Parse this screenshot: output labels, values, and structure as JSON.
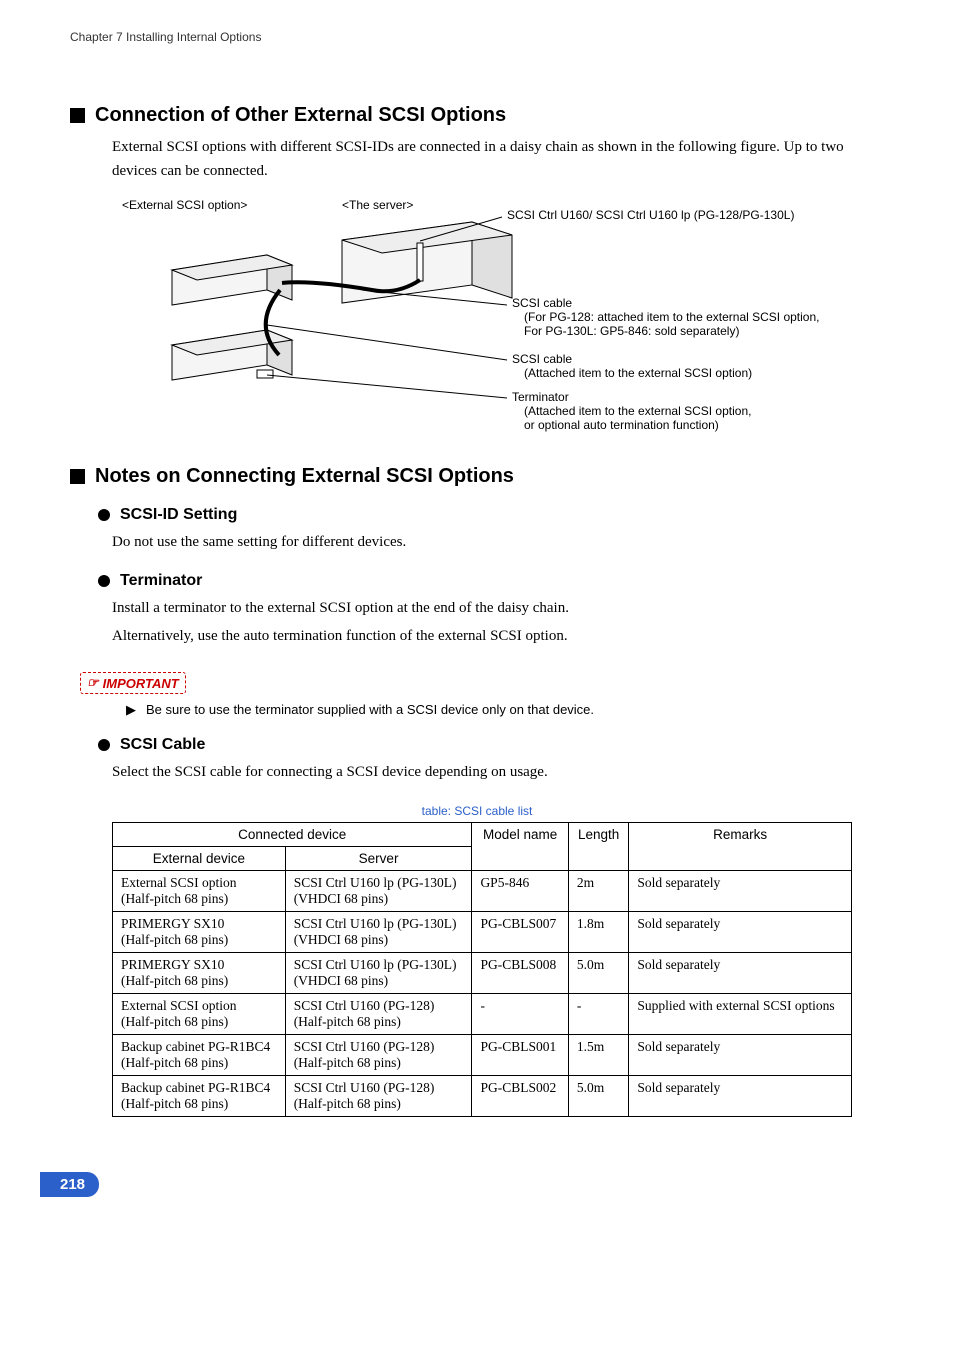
{
  "chapter_header": "Chapter 7  Installing Internal Options",
  "section1": {
    "title": "Connection of Other External SCSI Options",
    "para": "External SCSI options with different SCSI-IDs are connected in a daisy chain as shown in the following figure. Up to two devices can be connected."
  },
  "figure": {
    "labels": {
      "ext_option": "<External SCSI option>",
      "server": "<The server>",
      "ctrl": "SCSI Ctrl U160/ SCSI Ctrl U160 lp (PG-128/PG-130L)",
      "cable1_title": "SCSI cable",
      "cable1_l1": "(For PG-128: attached item to the external SCSI option,",
      "cable1_l2": " For PG-130L: GP5-846: sold separately)",
      "cable2_title": "SCSI cable",
      "cable2_l1": "(Attached item to the external SCSI option)",
      "term_title": "Terminator",
      "term_l1": "(Attached item to the external SCSI option,",
      "term_l2": " or optional auto termination function)"
    }
  },
  "section2": {
    "title": "Notes on Connecting External SCSI Options",
    "sub_scsi_id": {
      "title": "SCSI-ID Setting",
      "text": "Do not use the same setting for different devices."
    },
    "sub_term": {
      "title": "Terminator",
      "text1": "Install a terminator to the external SCSI option at the end of the daisy chain.",
      "text2": "Alternatively, use the auto termination function of the external SCSI option."
    },
    "important_label": "IMPORTANT",
    "important_note": "Be sure to use the terminator supplied with a SCSI device only on that device.",
    "sub_cable": {
      "title": "SCSI Cable",
      "text": "Select the SCSI cable for connecting a SCSI device depending on usage."
    }
  },
  "table": {
    "caption": "table: SCSI cable list",
    "headers": {
      "connected": "Connected device",
      "external": "External device",
      "server": "Server",
      "model": "Model name",
      "length": "Length",
      "remarks": "Remarks"
    },
    "rows": [
      {
        "ext_l1": "External SCSI option",
        "ext_l2": "(Half-pitch 68 pins)",
        "srv_l1": "SCSI Ctrl U160 lp (PG-130L)",
        "srv_l2": "(VHDCI 68 pins)",
        "model": "GP5-846",
        "length": "2m",
        "remarks": "Sold separately"
      },
      {
        "ext_l1": "PRIMERGY SX10",
        "ext_l2": "(Half-pitch 68 pins)",
        "srv_l1": "SCSI Ctrl U160 lp (PG-130L)",
        "srv_l2": "(VHDCI 68 pins)",
        "model": "PG-CBLS007",
        "length": "1.8m",
        "remarks": "Sold separately"
      },
      {
        "ext_l1": "PRIMERGY SX10",
        "ext_l2": "(Half-pitch 68 pins)",
        "srv_l1": "SCSI Ctrl U160 lp (PG-130L)",
        "srv_l2": "(VHDCI 68 pins)",
        "model": "PG-CBLS008",
        "length": "5.0m",
        "remarks": "Sold separately"
      },
      {
        "ext_l1": "External SCSI option",
        "ext_l2": "(Half-pitch 68 pins)",
        "srv_l1": "SCSI Ctrl U160 (PG-128)",
        "srv_l2": "(Half-pitch 68 pins)",
        "model": "-",
        "length": "-",
        "remarks": "Supplied with external SCSI options"
      },
      {
        "ext_l1": "Backup cabinet PG-R1BC4",
        "ext_l2": "(Half-pitch 68 pins)",
        "srv_l1": "SCSI Ctrl U160 (PG-128)",
        "srv_l2": "(Half-pitch 68 pins)",
        "model": "PG-CBLS001",
        "length": "1.5m",
        "remarks": "Sold separately"
      },
      {
        "ext_l1": "Backup cabinet PG-R1BC4",
        "ext_l2": " (Half-pitch 68 pins)",
        "srv_l1": "SCSI Ctrl U160 (PG-128)",
        "srv_l2": "(Half-pitch 68 pins)",
        "model": "PG-CBLS002",
        "length": "5.0m",
        "remarks": "Sold separately"
      }
    ]
  },
  "page_number": "218"
}
